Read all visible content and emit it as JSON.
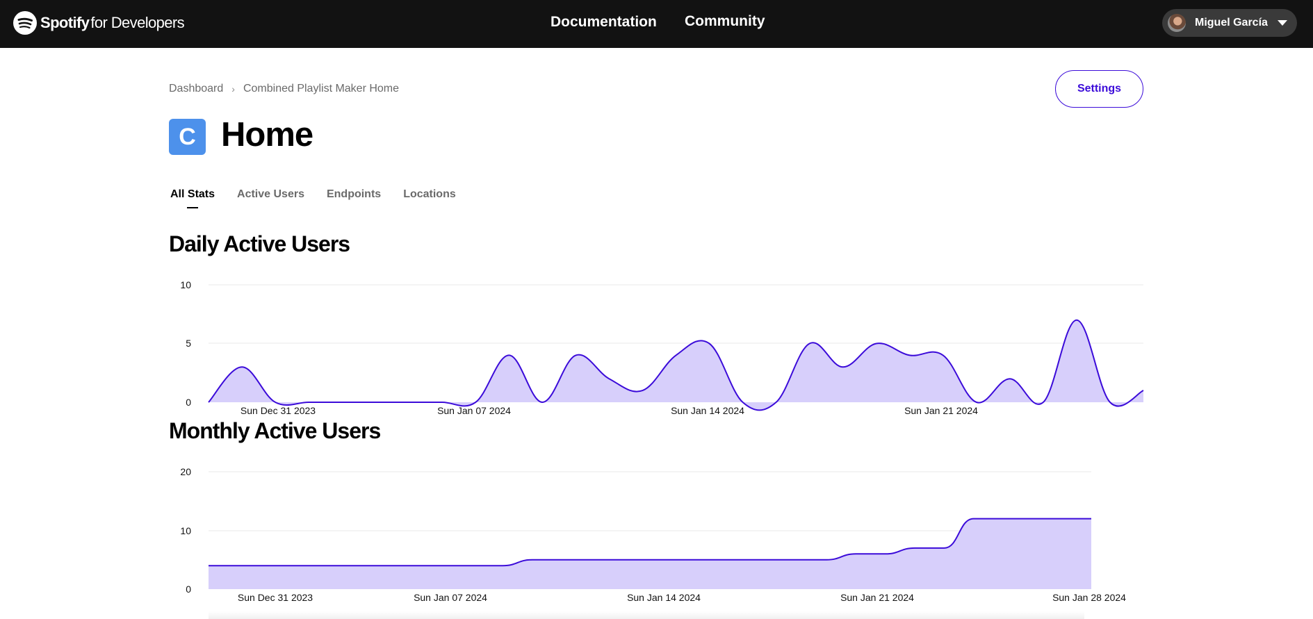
{
  "header": {
    "brand": "Spotify",
    "brand_suffix": "for Developers",
    "nav": [
      "Documentation",
      "Community"
    ],
    "user": {
      "name": "Miguel García",
      "avatar_icon": "avatar-photo"
    },
    "background": "#121212"
  },
  "breadcrumb": {
    "items": [
      "Dashboard",
      "Combined Playlist Maker Home"
    ],
    "separator": "›"
  },
  "settings_label": "Settings",
  "app": {
    "icon_letter": "C",
    "icon_color": "#4d91eb",
    "title": "Home"
  },
  "tabs": [
    {
      "label": "All Stats",
      "active": true
    },
    {
      "label": "Active Users",
      "active": false
    },
    {
      "label": "Endpoints",
      "active": false
    },
    {
      "label": "Locations",
      "active": false
    }
  ],
  "accent_color": "#3b0bd9",
  "fill_color": "#d7cffb",
  "chart_data": [
    {
      "type": "area",
      "title": "Daily Active Users",
      "ylim": [
        0,
        10
      ],
      "yticks": [
        "0",
        "5",
        "10"
      ],
      "x_tick_labels": [
        "Sun Dec 31 2023",
        "Sun Jan 07 2024",
        "Sun Jan 14 2024",
        "Sun Jan 21 2024"
      ],
      "x": [
        "2023-12-28",
        "2023-12-29",
        "2023-12-30",
        "2023-12-31",
        "2024-01-01",
        "2024-01-02",
        "2024-01-03",
        "2024-01-04",
        "2024-01-05",
        "2024-01-06",
        "2024-01-07",
        "2024-01-08",
        "2024-01-09",
        "2024-01-10",
        "2024-01-11",
        "2024-01-12",
        "2024-01-13",
        "2024-01-14",
        "2024-01-15",
        "2024-01-16",
        "2024-01-17",
        "2024-01-18",
        "2024-01-19",
        "2024-01-20",
        "2024-01-21",
        "2024-01-22",
        "2024-01-23",
        "2024-01-24",
        "2024-01-25",
        "2024-01-26",
        "2024-01-27",
        "2024-01-28"
      ],
      "values": [
        0,
        3,
        0,
        0,
        0,
        0,
        0,
        0,
        0,
        4,
        0,
        4,
        2,
        1,
        4,
        5,
        0,
        0,
        5,
        3,
        5,
        4,
        4,
        0,
        2,
        0,
        7,
        0,
        1
      ],
      "grid": true,
      "legend": "none"
    },
    {
      "type": "area",
      "title": "Monthly Active Users",
      "ylim": [
        0,
        20
      ],
      "yticks": [
        "0",
        "10",
        "20"
      ],
      "x_tick_labels": [
        "Sun Dec 31 2023",
        "Sun Jan 07 2024",
        "Sun Jan 14 2024",
        "Sun Jan 21 2024",
        "Sun Jan 28 2024"
      ],
      "values": [
        4,
        4,
        4,
        4,
        4,
        4,
        4,
        4,
        4,
        4,
        4,
        5,
        5,
        5,
        5,
        5,
        5,
        5,
        5,
        5,
        5,
        5,
        6,
        6,
        7,
        7,
        12,
        12,
        12,
        12,
        12
      ],
      "grid": true,
      "legend": "none"
    }
  ]
}
